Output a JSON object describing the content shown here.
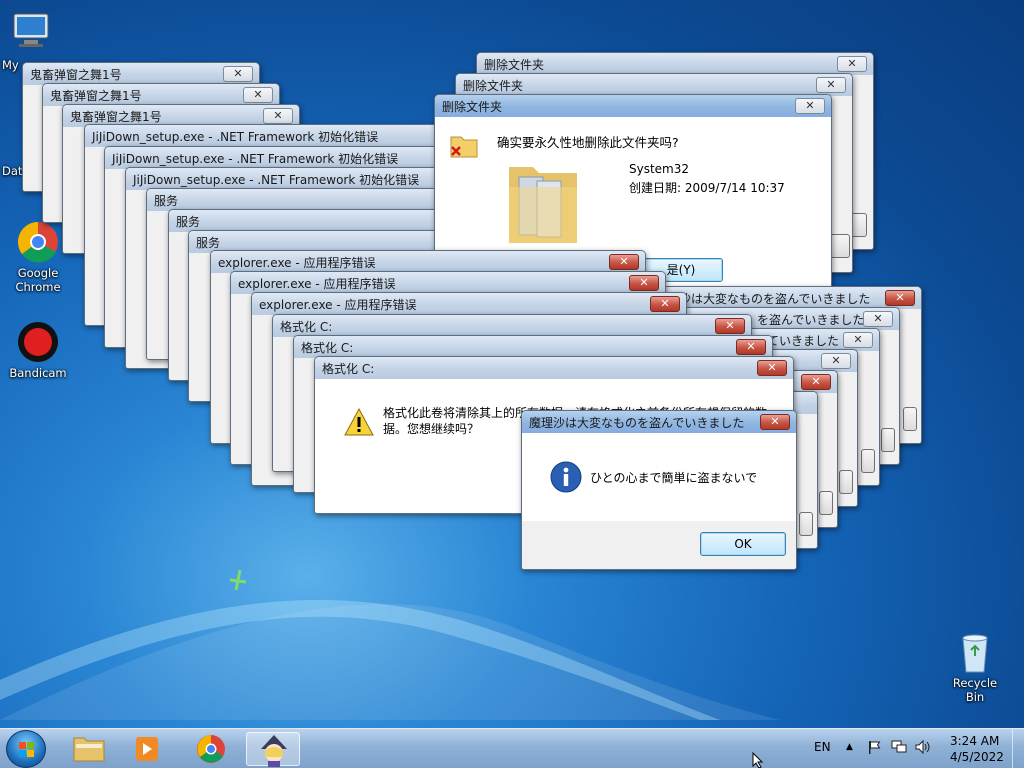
{
  "desktop": {
    "icons": [
      {
        "label": "My"
      },
      {
        "label": "Dat"
      },
      {
        "label": "Google Chrome"
      },
      {
        "label": "Bandicam"
      },
      {
        "label": "Recycle Bin"
      }
    ]
  },
  "windows": {
    "w1": {
      "title": "鬼畜弹窗之舞1号"
    },
    "w2": {
      "title": "鬼畜弹窗之舞1号"
    },
    "w3": {
      "title": "鬼畜弹窗之舞1号"
    },
    "w4": {
      "title": "JiJiDown_setup.exe - .NET Framework 初始化错误"
    },
    "w5": {
      "title": "JiJiDown_setup.exe - .NET Framework 初始化错误"
    },
    "w6": {
      "title": "JiJiDown_setup.exe - .NET Framework 初始化错误"
    },
    "w7": {
      "title": "服务"
    },
    "w8": {
      "title": "服务"
    },
    "w9": {
      "title": "服务"
    },
    "del1": {
      "title": "删除文件夹"
    },
    "del2": {
      "title": "删除文件夹"
    },
    "del3": {
      "title": "删除文件夹",
      "question": "确实要永久性地删除此文件夹吗?",
      "folder_name": "System32",
      "created_label": "创建日期: 2009/7/14 10:37",
      "yes_button": "是(Y)"
    },
    "exp1": {
      "title": "explorer.exe - 应用程序错误"
    },
    "exp2": {
      "title": "explorer.exe - 应用程序错误"
    },
    "exp3": {
      "title": "explorer.exe - 应用程序错误"
    },
    "fmt1": {
      "title": "格式化 C:"
    },
    "fmt2": {
      "title": "格式化 C:"
    },
    "fmt3": {
      "title": "格式化 C:",
      "message": "格式化此卷将清除其上的所有数据。请在格式化之前备份所有想保留的数据。您想继续吗？"
    },
    "ms_stack": {
      "title_short": "沙は大変なものを盗んでいきました",
      "title_mid": "を盗んでいきました",
      "title_tail": "ていきました"
    },
    "marisa": {
      "title": "魔理沙は大変なものを盗んでいきました",
      "message": "ひとの心まで簡単に盗まないで",
      "ok_button": "OK"
    }
  },
  "taskbar": {
    "language": "EN",
    "time": "3:24 AM",
    "date": "4/5/2022"
  }
}
